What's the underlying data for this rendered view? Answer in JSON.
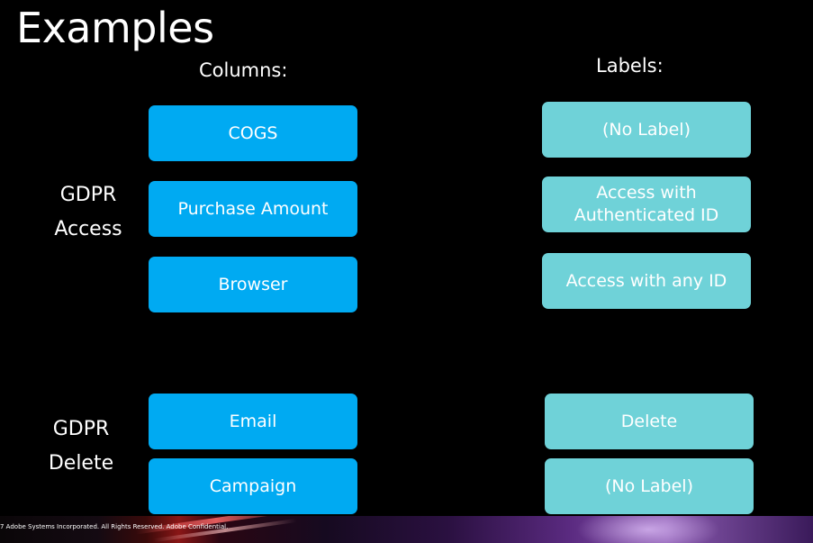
{
  "title": "Examples",
  "columns_heading": "Columns:",
  "labels_heading": "Labels:",
  "groups": {
    "access": {
      "line1": "GDPR",
      "line2": "Access"
    },
    "delete": {
      "line1": "GDPR",
      "line2": "Delete"
    }
  },
  "columns": {
    "cogs": "COGS",
    "purchase_amount": "Purchase Amount",
    "browser": "Browser",
    "email": "Email",
    "campaign": "Campaign"
  },
  "labels": {
    "no_label_1": "(No Label)",
    "access_auth_line1": "Access with",
    "access_auth_line2": "Authenticated ID",
    "access_any": "Access with any ID",
    "delete": "Delete",
    "no_label_2": "(No Label)"
  },
  "footer": "7 Adobe Systems Incorporated.  All Rights Reserved.  Adobe Confidential.",
  "colors": {
    "column_box": "#00aaf2",
    "label_box": "#6fd2d8",
    "background": "#000000"
  }
}
